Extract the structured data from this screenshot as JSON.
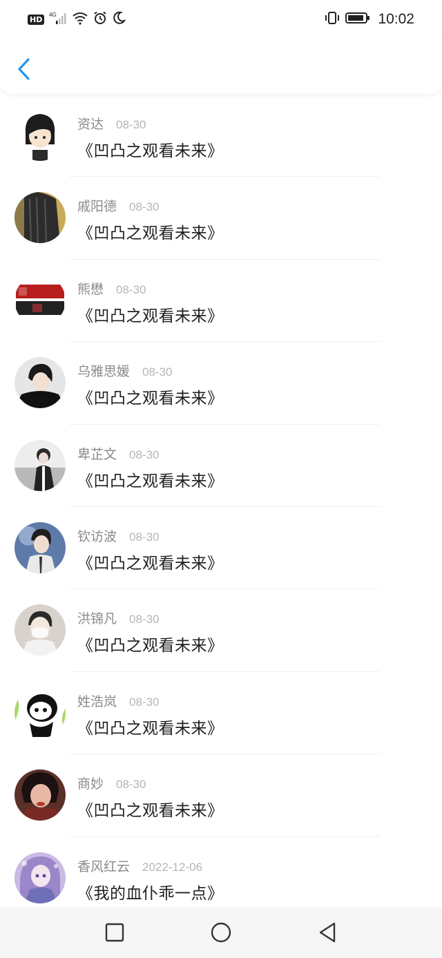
{
  "status_bar": {
    "hd": "HD",
    "network": "4G",
    "time": "10:02",
    "icons": [
      "signal-icon",
      "wifi-icon",
      "alarm-icon",
      "moon-icon",
      "vibrate-icon",
      "battery-icon"
    ]
  },
  "header": {
    "back_icon": "chevron-left-icon",
    "accent": "#2196F3"
  },
  "items": [
    {
      "name": "资达",
      "date": "08-30",
      "title": "《凹凸之观看未来》",
      "avatar_color": "#e8e8e8"
    },
    {
      "name": "戚阳德",
      "date": "08-30",
      "title": "《凹凸之观看未来》",
      "avatar_color": "#b0a48a"
    },
    {
      "name": "熊懋",
      "date": "08-30",
      "title": "《凹凸之观看未来》",
      "avatar_color": "#ffffff"
    },
    {
      "name": "乌雅思媛",
      "date": "08-30",
      "title": "《凹凸之观看未来》",
      "avatar_color": "#6d6d6d"
    },
    {
      "name": "卑芷文",
      "date": "08-30",
      "title": "《凹凸之观看未来》",
      "avatar_color": "#cfcfcf"
    },
    {
      "name": "钦访波",
      "date": "08-30",
      "title": "《凹凸之观看未来》",
      "avatar_color": "#7b8fb3"
    },
    {
      "name": "洪锦凡",
      "date": "08-30",
      "title": "《凹凸之观看未来》",
      "avatar_color": "#d8d2cc"
    },
    {
      "name": "姓浩岚",
      "date": "08-30",
      "title": "《凹凸之观看未来》",
      "avatar_color": "#9bd35a"
    },
    {
      "name": "商妙",
      "date": "08-30",
      "title": "《凹凸之观看未来》",
      "avatar_color": "#8a4a3a"
    },
    {
      "name": "香风红云",
      "date": "2022-12-06",
      "title": "《我的血仆乖一点》",
      "avatar_color": "#b9a7d6"
    }
  ],
  "nav": {
    "buttons": [
      "square-icon",
      "circle-icon",
      "triangle-back-icon"
    ]
  }
}
